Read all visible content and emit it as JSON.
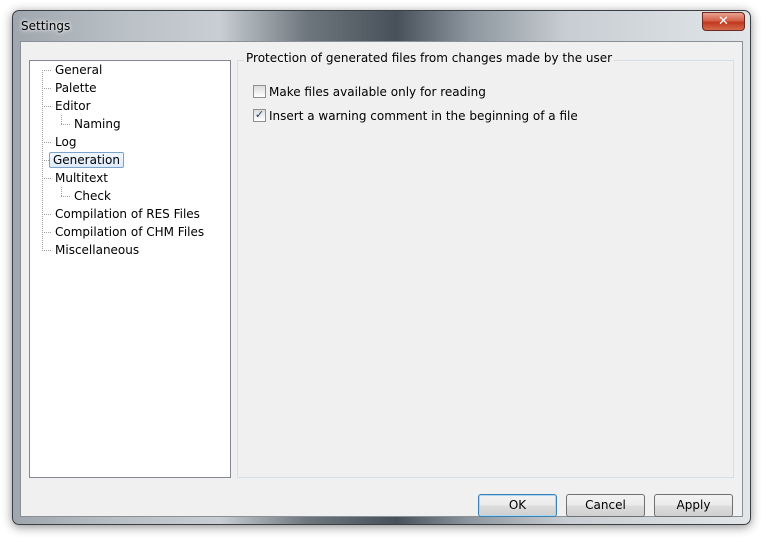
{
  "window": {
    "title": "Settings",
    "close_glyph": "✕"
  },
  "tree": {
    "items": [
      {
        "label": "General"
      },
      {
        "label": "Palette"
      },
      {
        "label": "Editor"
      },
      {
        "label": "Naming"
      },
      {
        "label": "Log"
      },
      {
        "label": "Generation"
      },
      {
        "label": "Multitext"
      },
      {
        "label": "Check"
      },
      {
        "label": "Compilation of RES Files"
      },
      {
        "label": "Compilation of CHM Files"
      },
      {
        "label": "Miscellaneous"
      }
    ],
    "selected": "Generation"
  },
  "panel": {
    "heading": "Protection of generated files from changes made by the user",
    "options": [
      {
        "label": "Make files available only for reading",
        "checked": false
      },
      {
        "label": "Insert a warning comment in the beginning of a file",
        "checked": true
      }
    ]
  },
  "buttons": {
    "ok": "OK",
    "cancel": "Cancel",
    "apply": "Apply"
  },
  "icons": {
    "check_mark": "✓"
  }
}
